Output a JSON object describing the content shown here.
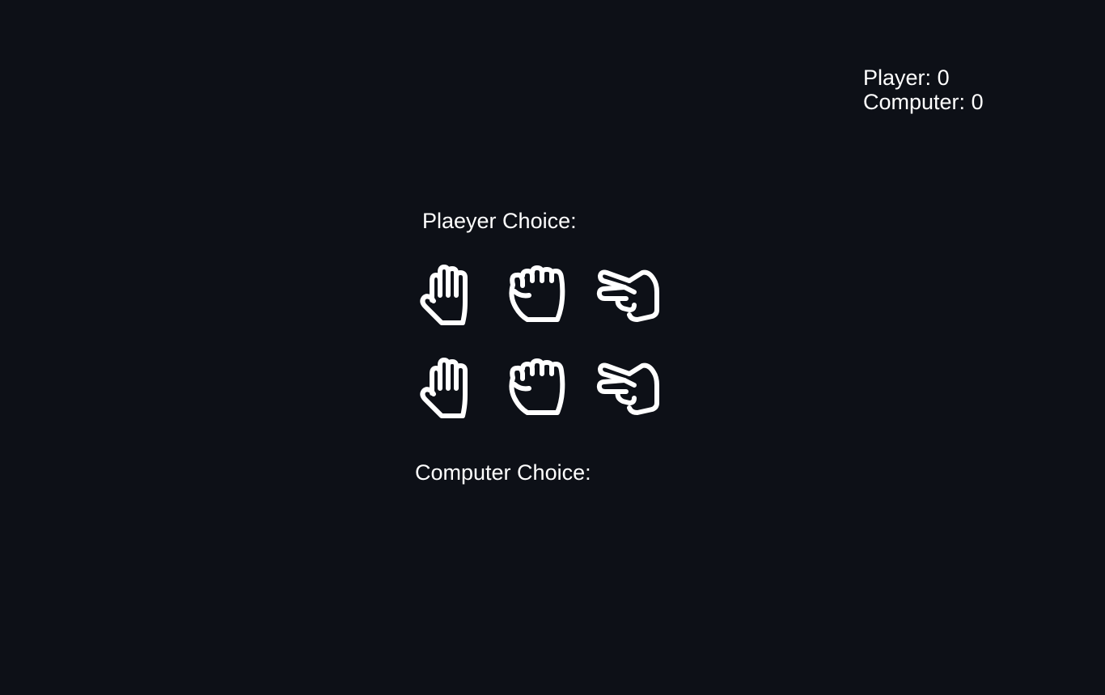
{
  "scoreboard": {
    "player_label": "Player:",
    "player_score": "0",
    "computer_label": "Computer:",
    "computer_score": "0"
  },
  "player_choice": {
    "label": "Plaeyer Choice:",
    "options": [
      {
        "name": "paper",
        "icon": "hand-paper-icon"
      },
      {
        "name": "rock",
        "icon": "hand-rock-icon"
      },
      {
        "name": "scissors",
        "icon": "hand-scissors-icon"
      }
    ]
  },
  "computer_choice": {
    "label": "Computer Choice:",
    "options": [
      {
        "name": "paper",
        "icon": "hand-paper-icon"
      },
      {
        "name": "rock",
        "icon": "hand-rock-icon"
      },
      {
        "name": "scissors",
        "icon": "hand-scissors-icon"
      }
    ]
  },
  "colors": {
    "background": "#0d1017",
    "foreground": "#ffffff"
  }
}
